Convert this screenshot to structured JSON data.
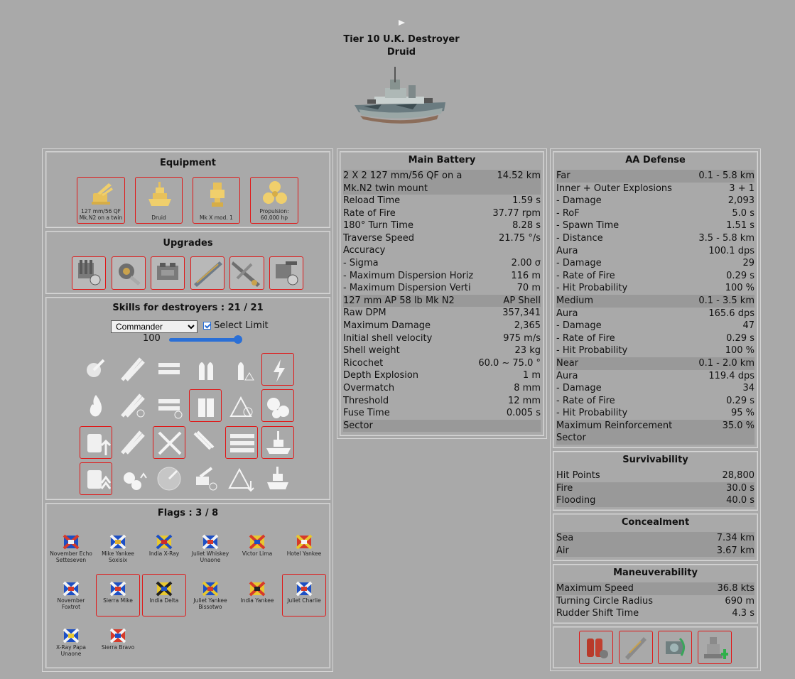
{
  "header": {
    "tier_line": "Tier 10 U.K. Destroyer",
    "ship_name": "Druid"
  },
  "equipment": {
    "title": "Equipment",
    "items": [
      {
        "label": "127 mm/56 QF Mk.N2 on a twin",
        "icon": "gun-turret-icon"
      },
      {
        "label": "Druid",
        "icon": "hull-icon"
      },
      {
        "label": "Mk X mod. 1",
        "icon": "fire-control-icon"
      },
      {
        "label": "Propulsion: 60,000 hp",
        "icon": "propeller-icon"
      }
    ]
  },
  "upgrades": {
    "title": "Upgrades",
    "items": [
      "main-armaments-mod-icon",
      "damage-control-mod-icon",
      "propulsion-mod-icon",
      "steering-gears-mod-icon",
      "torpedo-mod-icon",
      "aiming-systems-mod-icon"
    ]
  },
  "skills": {
    "title": "Skills for destroyers : 21 / 21",
    "commander_select": "Commander",
    "select_limit_label": "Select Limit",
    "limit_value": "100",
    "limit_fraction": 1.0,
    "rows": [
      [
        {
          "icon": "gun-feeder-icon",
          "sel": false
        },
        {
          "icon": "torpedo-armament-icon",
          "sel": false
        },
        {
          "icon": "fill-the-tubes-icon",
          "sel": false
        },
        {
          "icon": "shells-icon",
          "sel": false
        },
        {
          "icon": "warning-shell-icon",
          "sel": false
        },
        {
          "icon": "last-stand-icon",
          "sel": true
        }
      ],
      [
        {
          "icon": "fire-icon",
          "sel": false
        },
        {
          "icon": "torpedo-speed-icon",
          "sel": false
        },
        {
          "icon": "tubes-reload-icon",
          "sel": false
        },
        {
          "icon": "ammo-icon",
          "sel": true
        },
        {
          "icon": "priority-target-icon",
          "sel": false
        },
        {
          "icon": "engine-propeller-icon",
          "sel": true
        }
      ],
      [
        {
          "icon": "extra-heavy-ammo-icon",
          "sel": true
        },
        {
          "icon": "swift-fish-icon",
          "sel": false
        },
        {
          "icon": "crossed-swords-icon",
          "sel": true
        },
        {
          "icon": "aa-barrage-icon",
          "sel": false
        },
        {
          "icon": "launcher-rack-icon",
          "sel": true
        },
        {
          "icon": "ship-silhouette-icon",
          "sel": true
        }
      ],
      [
        {
          "icon": "super-charge-icon",
          "sel": true
        },
        {
          "icon": "propeller-up-icon",
          "sel": false
        },
        {
          "icon": "radar-icon",
          "sel": false
        },
        {
          "icon": "aa-gun-reload-icon",
          "sel": false
        },
        {
          "icon": "warning-down-icon",
          "sel": false
        },
        {
          "icon": "concealment-icon",
          "sel": false
        }
      ]
    ]
  },
  "flags": {
    "title": "Flags : 3 / 8",
    "items": [
      {
        "label": "November Echo Setteseven",
        "sel": false
      },
      {
        "label": "Mike Yankee Soxisix",
        "sel": false
      },
      {
        "label": "India X-Ray",
        "sel": false
      },
      {
        "label": "Juliet Whiskey Unaone",
        "sel": false
      },
      {
        "label": "Victor Lima",
        "sel": false
      },
      {
        "label": "Hotel Yankee",
        "sel": false
      },
      {
        "label": "November Foxtrot",
        "sel": false
      },
      {
        "label": "Sierra Mike",
        "sel": true
      },
      {
        "label": "India Delta",
        "sel": true
      },
      {
        "label": "Juliet Yankee Bissotwo",
        "sel": false
      },
      {
        "label": "India Yankee",
        "sel": false
      },
      {
        "label": "Juliet Charlie",
        "sel": true
      },
      {
        "label": "X-Ray Papa Unaone",
        "sel": false
      },
      {
        "label": "Sierra Bravo",
        "sel": false
      }
    ]
  },
  "main_battery": {
    "title": "Main Battery",
    "rows": [
      {
        "k": "2 X 2 127 mm/56 QF on a Mk.N2 twin mount",
        "v": "14.52 km",
        "sh": true,
        "tall": true
      },
      {
        "k": "Reload Time",
        "v": "1.59 s",
        "sh": false
      },
      {
        "k": "Rate of Fire",
        "v": "37.77 rpm",
        "sh": false
      },
      {
        "k": "180° Turn Time",
        "v": "8.28 s",
        "sh": false
      },
      {
        "k": "Traverse Speed",
        "v": "21.75 °/s",
        "sh": false
      },
      {
        "k": "Accuracy",
        "v": "",
        "sh": false
      },
      {
        "k": "- Sigma",
        "v": "2.00 σ",
        "sh": false
      },
      {
        "k": "- Maximum Dispersion Horiz",
        "v": "116 m",
        "sh": false
      },
      {
        "k": "- Maximum Dispersion Verti",
        "v": "70 m",
        "sh": false
      },
      {
        "k": "127 mm AP 58 lb Mk N2",
        "v": "AP Shell",
        "sh": true
      },
      {
        "k": "Raw DPM",
        "v": "357,341",
        "sh": false
      },
      {
        "k": "Maximum Damage",
        "v": "2,365",
        "sh": false
      },
      {
        "k": "Initial shell velocity",
        "v": "975 m/s",
        "sh": false
      },
      {
        "k": "Shell weight",
        "v": "23 kg",
        "sh": false
      },
      {
        "k": "Ricochet",
        "v": "60.0 ~ 75.0 °",
        "sh": false
      },
      {
        "k": "Depth Explosion",
        "v": "1 m",
        "sh": false
      },
      {
        "k": "Overmatch",
        "v": "8 mm",
        "sh": false
      },
      {
        "k": "Threshold",
        "v": "12 mm",
        "sh": false
      },
      {
        "k": "Fuse Time",
        "v": "0.005 s",
        "sh": false
      },
      {
        "k": "Sector",
        "v": "",
        "sh": true
      }
    ]
  },
  "aa_defense": {
    "title": "AA Defense",
    "rows": [
      {
        "k": "Far",
        "v": "0.1 - 5.8 km",
        "sh": true
      },
      {
        "k": "Inner + Outer Explosions",
        "v": "3 + 1",
        "sh": false
      },
      {
        "k": "- Damage",
        "v": "2,093",
        "sh": false
      },
      {
        "k": "- RoF",
        "v": "5.0 s",
        "sh": false
      },
      {
        "k": "- Spawn Time",
        "v": "1.51 s",
        "sh": false
      },
      {
        "k": "- Distance",
        "v": "3.5 - 5.8 km",
        "sh": false
      },
      {
        "k": "Aura",
        "v": "100.1 dps",
        "sh": false
      },
      {
        "k": "- Damage",
        "v": "29",
        "sh": false
      },
      {
        "k": "- Rate of Fire",
        "v": "0.29 s",
        "sh": false
      },
      {
        "k": "- Hit Probability",
        "v": "100 %",
        "sh": false
      },
      {
        "k": "Medium",
        "v": "0.1 - 3.5 km",
        "sh": true
      },
      {
        "k": "Aura",
        "v": "165.6 dps",
        "sh": false
      },
      {
        "k": "- Damage",
        "v": "47",
        "sh": false
      },
      {
        "k": "- Rate of Fire",
        "v": "0.29 s",
        "sh": false
      },
      {
        "k": "- Hit Probability",
        "v": "100 %",
        "sh": false
      },
      {
        "k": "Near",
        "v": "0.1 - 2.0 km",
        "sh": true
      },
      {
        "k": "Aura",
        "v": "119.4 dps",
        "sh": false
      },
      {
        "k": "- Damage",
        "v": "34",
        "sh": false
      },
      {
        "k": "- Rate of Fire",
        "v": "0.29 s",
        "sh": false
      },
      {
        "k": "- Hit Probability",
        "v": "95 %",
        "sh": false
      },
      {
        "k": "Maximum Reinforcement",
        "v": "35.0 %",
        "sh": true
      },
      {
        "k": "Sector",
        "v": "",
        "sh": true
      }
    ]
  },
  "survivability": {
    "title": "Survivability",
    "rows": [
      {
        "k": "Hit Points",
        "v": "28,800",
        "sh": false
      },
      {
        "k": "Fire",
        "v": "30.0 s",
        "sh": true
      },
      {
        "k": "Flooding",
        "v": "40.0 s",
        "sh": true
      }
    ]
  },
  "concealment": {
    "title": "Concealment",
    "rows": [
      {
        "k": "Sea",
        "v": "7.34 km",
        "sh": true
      },
      {
        "k": "Air",
        "v": "3.67 km",
        "sh": true
      }
    ]
  },
  "maneuverability": {
    "title": "Maneuverability",
    "rows": [
      {
        "k": "Maximum Speed",
        "v": "36.8 kts",
        "sh": true
      },
      {
        "k": "Turning Circle Radius",
        "v": "690 m",
        "sh": false
      },
      {
        "k": "Rudder Shift Time",
        "v": "4.3 s",
        "sh": false
      }
    ]
  },
  "consumables": [
    "damage-control-party-icon",
    "smoke-generator-icon",
    "engine-boost-icon",
    "repair-party-icon"
  ]
}
